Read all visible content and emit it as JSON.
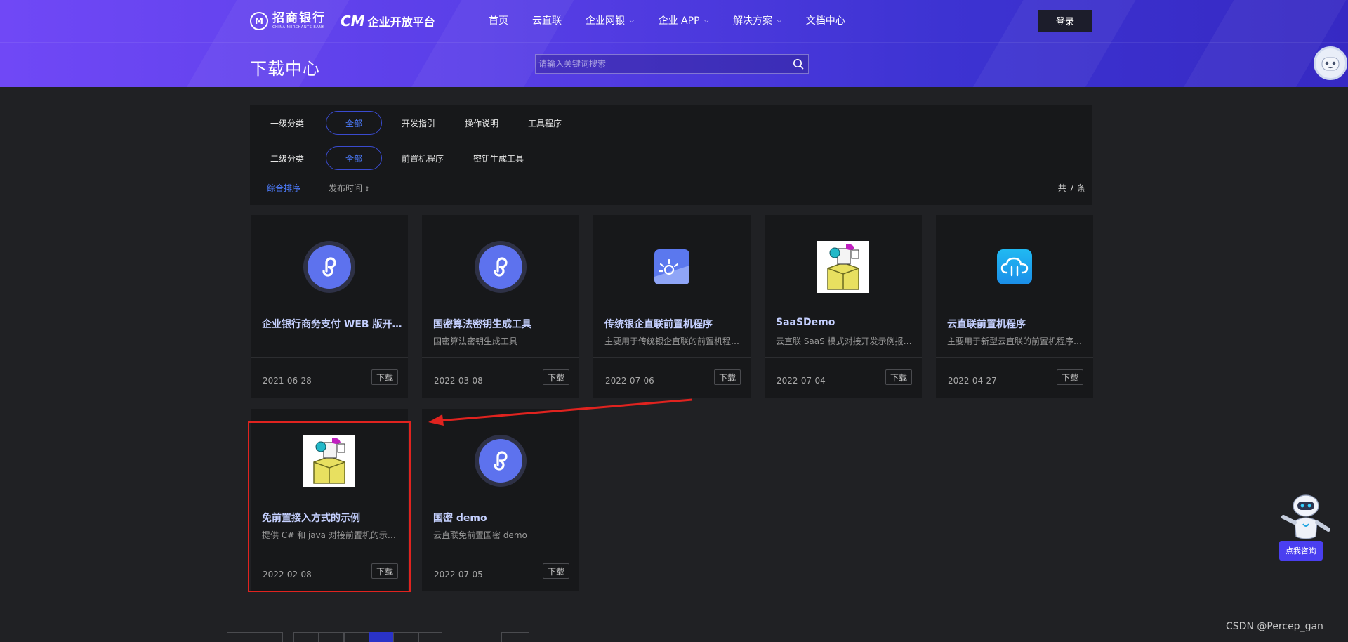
{
  "header": {
    "logo_bank_cn": "招商银行",
    "logo_bank_en": "CHINA MERCHANTS BANK",
    "logo_platform": "企业开放平台",
    "nav": [
      {
        "label": "首页",
        "has_dropdown": false
      },
      {
        "label": "云直联",
        "has_dropdown": false
      },
      {
        "label": "企业网银",
        "has_dropdown": true
      },
      {
        "label": "企业 APP",
        "has_dropdown": true
      },
      {
        "label": "解决方案",
        "has_dropdown": true
      },
      {
        "label": "文档中心",
        "has_dropdown": false
      }
    ],
    "login_label": "登录",
    "page_title": "下载中心",
    "search_placeholder": "请输入关键词搜索"
  },
  "filters": {
    "primary": {
      "label": "一级分类",
      "options": [
        "全部",
        "开发指引",
        "操作说明",
        "工具程序"
      ],
      "active": "全部"
    },
    "secondary": {
      "label": "二级分类",
      "options": [
        "全部",
        "前置机程序",
        "密钥生成工具"
      ],
      "active": "全部"
    },
    "sort": {
      "default_label": "综合排序",
      "time_label": "发布时间",
      "time_arrow": "⇕"
    },
    "total": "共 7 条"
  },
  "cards": [
    {
      "icon": "miniprogram-icon",
      "title": "企业银行商务支付 WEB 版开发示例",
      "desc": "",
      "date": "2021-06-28",
      "download_label": "下载"
    },
    {
      "icon": "miniprogram-icon",
      "title": "国密算法密钥生成工具",
      "desc": "国密算法密钥生成工具",
      "date": "2022-03-08",
      "download_label": "下载"
    },
    {
      "icon": "sunrise-app-icon",
      "title": "传统银企直联前置机程序",
      "desc": "主要用于传统银企直联的前置机程序下载",
      "date": "2022-07-06",
      "download_label": "下载"
    },
    {
      "icon": "installer-package-icon",
      "title": "SaaSDemo",
      "desc": "云直联 SaaS 模式对接开发示例报文说明",
      "date": "2022-07-04",
      "download_label": "下载"
    },
    {
      "icon": "cloud-app-icon",
      "title": "云直联前置机程序",
      "desc": "主要用于新型云直联的前置机程序，支持自动更新",
      "date": "2022-04-27",
      "download_label": "下载"
    },
    {
      "icon": "installer-package-icon",
      "title": "免前置接入方式的示例",
      "desc": "提供 C# 和 java 对接前置机的示例代码",
      "date": "2022-02-08",
      "download_label": "下载"
    },
    {
      "icon": "miniprogram-icon",
      "title": "国密 demo",
      "desc": "云直联免前置国密 demo",
      "date": "2022-07-05",
      "download_label": "下载"
    }
  ],
  "assistant": {
    "consult_label": "点我咨询"
  },
  "watermark": "CSDN @Percep_gan",
  "colors": {
    "accent": "#4e7dff",
    "annotation_red": "#e0231f",
    "banner_start": "#7048f6",
    "banner_end": "#3629c3"
  }
}
